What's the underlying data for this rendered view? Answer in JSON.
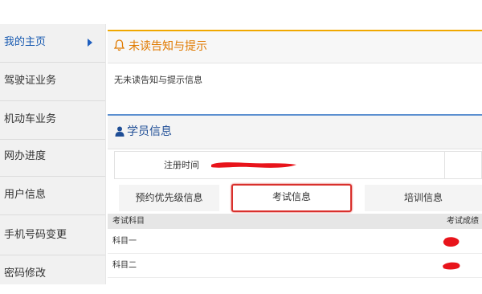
{
  "sidebar": {
    "items": [
      {
        "label": "我的主页",
        "active": true
      },
      {
        "label": "驾驶证业务"
      },
      {
        "label": "机动车业务"
      },
      {
        "label": "网办进度"
      },
      {
        "label": "用户信息"
      },
      {
        "label": "手机号码变更"
      },
      {
        "label": "密码修改"
      }
    ]
  },
  "notice": {
    "icon": "bell-icon",
    "title": "未读告知与提示",
    "body": "无未读告知与提示信息",
    "accent": "#f0a800"
  },
  "student": {
    "icon": "user-icon",
    "title": "学员信息",
    "reg_label": "注册时间",
    "accent": "#5b8fd0"
  },
  "tabs": [
    {
      "label": "预约优先级信息"
    },
    {
      "label": "考试信息",
      "active": true
    },
    {
      "label": "培训信息"
    }
  ],
  "exam_table": {
    "headers": [
      "考试科目",
      "考试成绩"
    ],
    "rows": [
      {
        "subject": "科目一"
      },
      {
        "subject": "科目二"
      }
    ]
  },
  "redaction_color": "#e8141b"
}
